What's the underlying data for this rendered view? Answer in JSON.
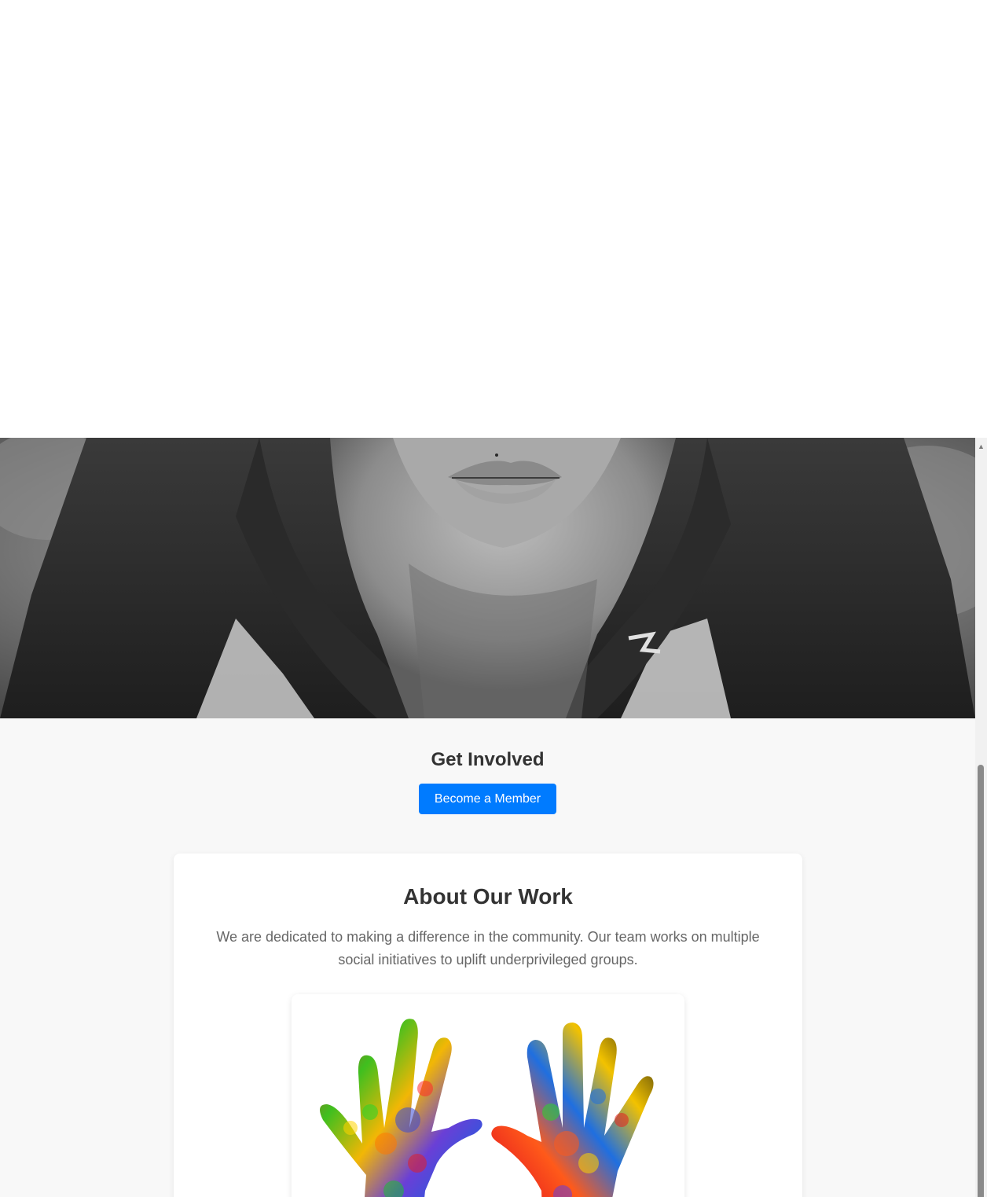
{
  "hero": {
    "image": "child-portrait-bw"
  },
  "get_involved": {
    "title": "Get Involved",
    "button_label": "Become a Member"
  },
  "about": {
    "title": "About Our Work",
    "description": "We are dedicated to making a difference in the community. Our team works on multiple social initiatives to uplift underprivileged groups.",
    "image": "colorful-hands"
  },
  "scrollbar": {
    "up_icon": "▲"
  },
  "colors": {
    "accent": "#007bff",
    "heading": "#333333",
    "body_text": "#666666",
    "page_bg": "#f8f8f8"
  }
}
